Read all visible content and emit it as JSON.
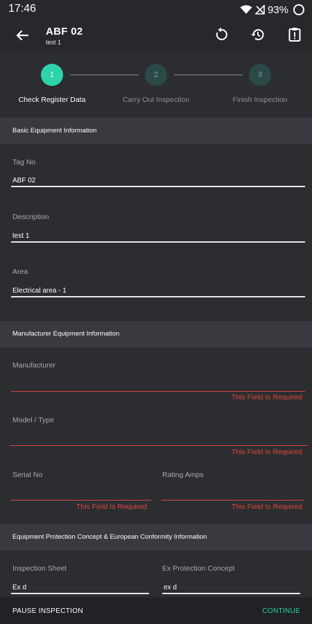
{
  "status_bar": {
    "time": "17:46",
    "battery": "93%"
  },
  "app_bar": {
    "title": "ABF 02",
    "subtitle": "test 1"
  },
  "stepper": {
    "steps": [
      {
        "number": "1",
        "label": "Check Register Data"
      },
      {
        "number": "2",
        "label": "Carry Out Inspection"
      },
      {
        "number": "3",
        "label": "Finish Inspection"
      }
    ]
  },
  "sections": {
    "basic": "Basic Equipment Information",
    "manufacturer": "Manufacturer Equipment Information",
    "protection": "Equipment Protection Concept & European Conformity Information"
  },
  "fields": {
    "tag_no": {
      "label": "Tag No",
      "value": "ABF 02"
    },
    "description": {
      "label": "Description",
      "value": "test 1"
    },
    "area": {
      "label": "Area",
      "value": "Electrical area - 1"
    },
    "manufacturer": {
      "label": "Manufacturer",
      "value": "",
      "error": "This Field Is Required"
    },
    "model_type": {
      "label": "Model / Type",
      "value": "",
      "error": "This Field Is Required"
    },
    "serial_no": {
      "label": "Serial No",
      "value": "",
      "error": "This Field Is Required"
    },
    "rating_amps": {
      "label": "Rating Amps",
      "value": "",
      "error": "This Field Is Required"
    },
    "inspection_sheet": {
      "label": "Inspection Sheet",
      "value": "Ex d"
    },
    "ex_protection_concept": {
      "label": "Ex Protection Concept",
      "value": "ex d"
    }
  },
  "bottom_bar": {
    "pause_label": "PAUSE INSPECTION",
    "continue_label": "CONTINUE"
  },
  "colors": {
    "accent": "#2ed3a9",
    "error": "#e0493b",
    "background": "#2b2d31",
    "section": "#383a3f"
  }
}
